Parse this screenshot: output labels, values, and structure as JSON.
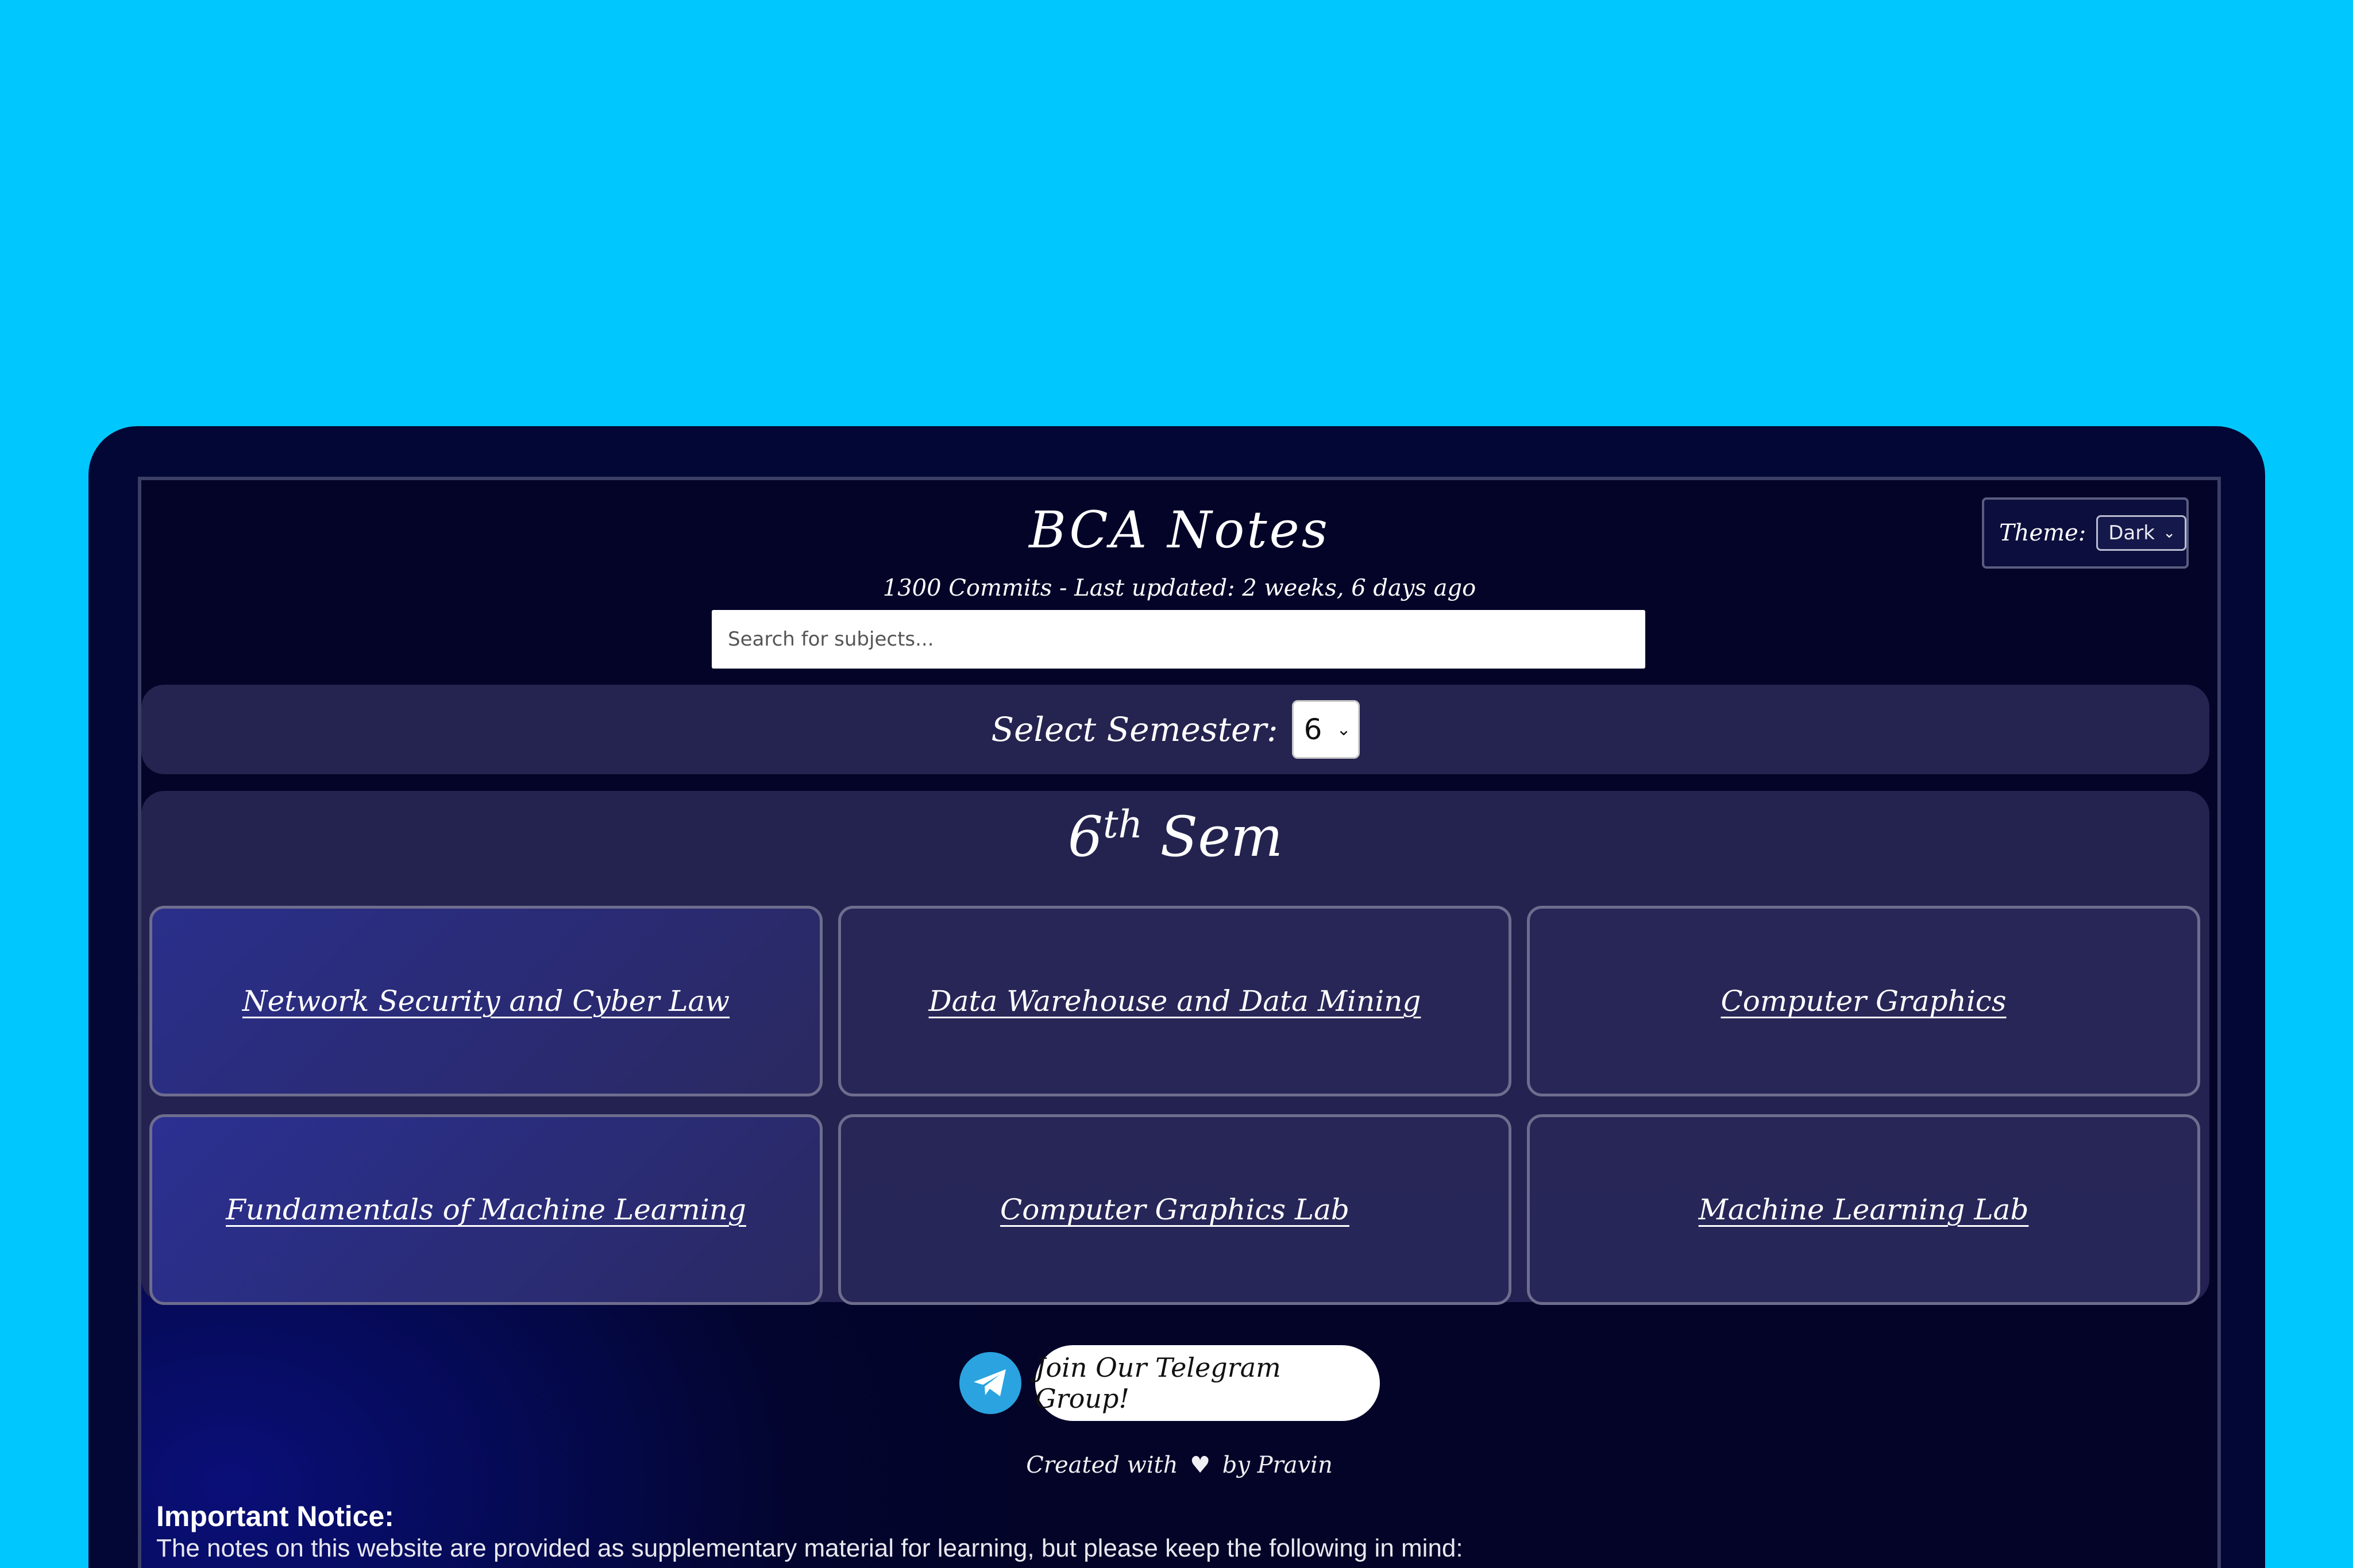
{
  "header": {
    "title": "BCA Notes",
    "commits_text": "1300 Commits - Last updated: 2 weeks, 6 days ago"
  },
  "theme": {
    "label": "Theme:",
    "selected": "Dark"
  },
  "search": {
    "placeholder": "Search for subjects..."
  },
  "semester": {
    "label": "Select Semester:",
    "selected": "6",
    "heading_number": "6",
    "heading_suffix": "th",
    "heading_word": "Sem"
  },
  "subjects": [
    "Network Security and Cyber Law",
    "Data Warehouse and Data Mining",
    "Computer Graphics",
    "Fundamentals of Machine Learning",
    "Computer Graphics Lab",
    "Machine Learning Lab"
  ],
  "telegram": {
    "icon": "telegram-icon",
    "button_label": "Join Our Telegram Group!",
    "brand_color": "#2aa3e0"
  },
  "footer": {
    "created_prefix": "Created with",
    "heart": "♥",
    "created_suffix": "by Pravin"
  },
  "notice": {
    "title": "Important Notice:",
    "text": "The notes on this website are provided as supplementary material for learning, but please keep the following in mind:"
  },
  "colors": {
    "background": "#00c8ff",
    "page_dark": "#030428",
    "panel": "#25234f"
  }
}
